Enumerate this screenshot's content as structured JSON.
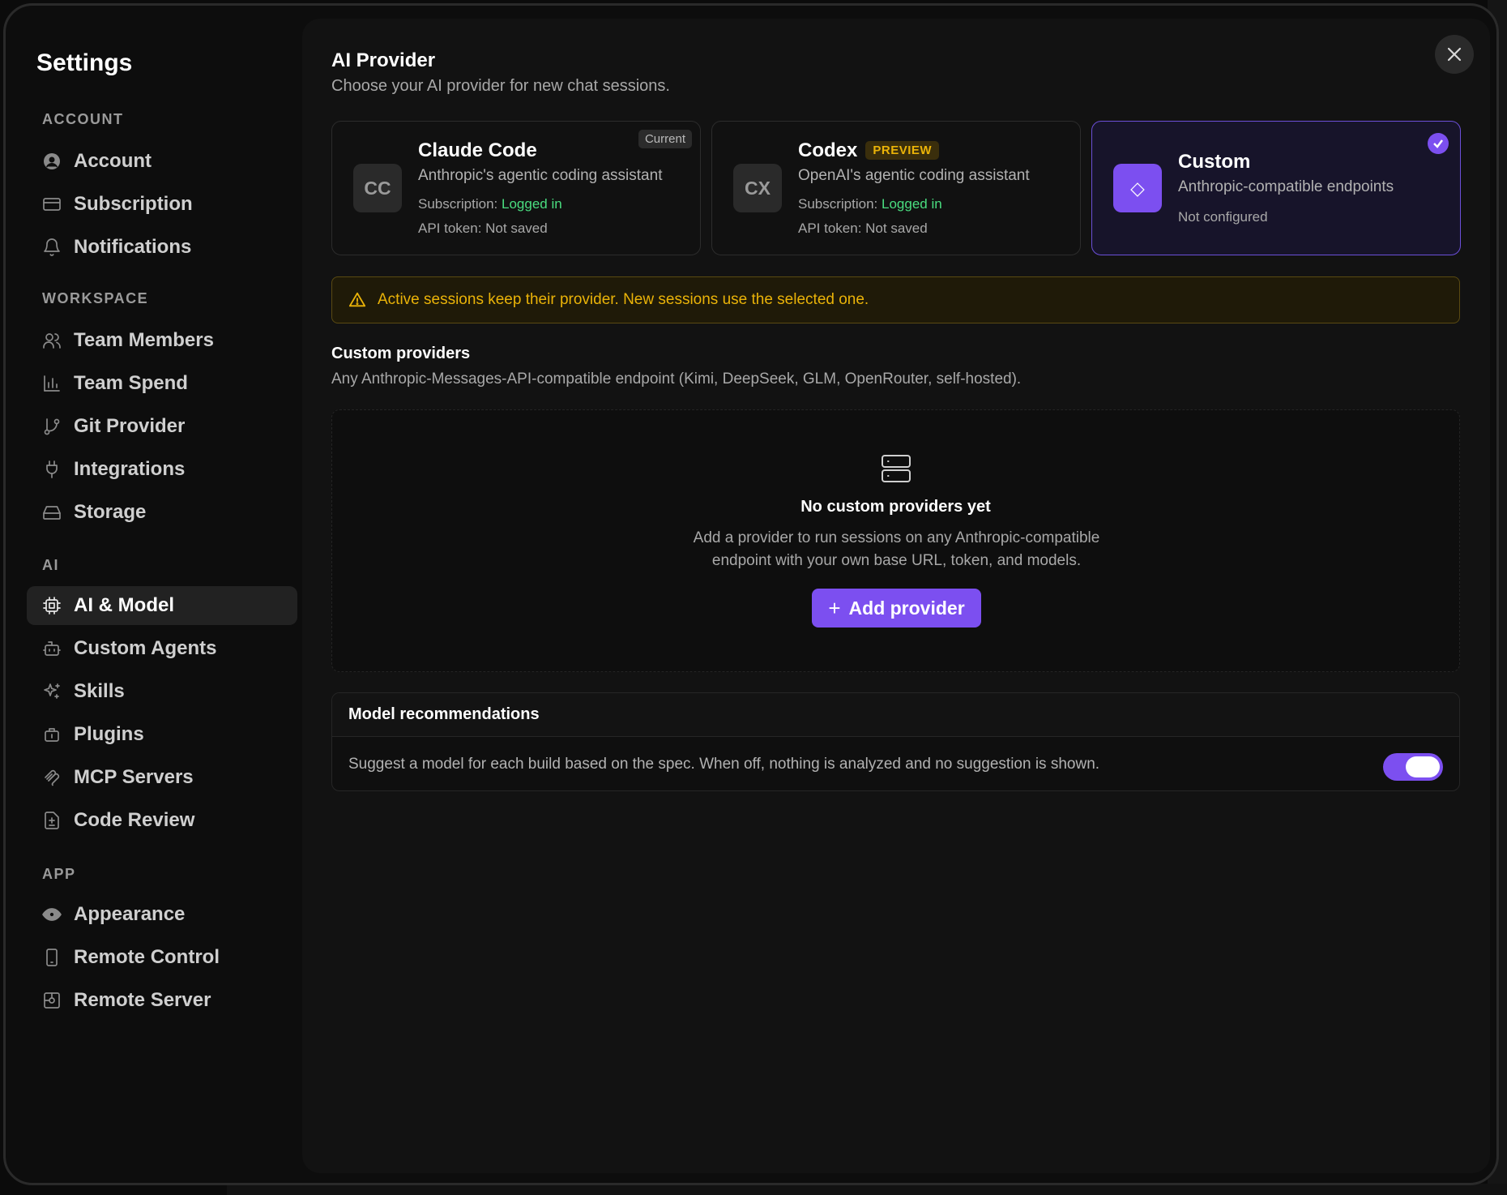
{
  "sidebar": {
    "title": "Settings",
    "groups": [
      {
        "label": "ACCOUNT"
      },
      {
        "label": "WORKSPACE"
      },
      {
        "label": "AI"
      },
      {
        "label": "APP"
      }
    ],
    "items": [
      {
        "label": "Account",
        "icon": "user-circle-icon"
      },
      {
        "label": "Subscription",
        "icon": "credit-card-icon"
      },
      {
        "label": "Notifications",
        "icon": "bell-icon"
      },
      {
        "label": "Team Members",
        "icon": "users-icon"
      },
      {
        "label": "Team Spend",
        "icon": "bar-chart-icon"
      },
      {
        "label": "Git Provider",
        "icon": "git-branch-icon"
      },
      {
        "label": "Integrations",
        "icon": "plug-icon"
      },
      {
        "label": "Storage",
        "icon": "hard-drive-icon"
      },
      {
        "label": "AI & Model",
        "icon": "cpu-icon",
        "active": true
      },
      {
        "label": "Custom Agents",
        "icon": "bot-icon"
      },
      {
        "label": "Skills",
        "icon": "sparkles-icon"
      },
      {
        "label": "Plugins",
        "icon": "puzzle-icon"
      },
      {
        "label": "MCP Servers",
        "icon": "mcp-icon"
      },
      {
        "label": "Code Review",
        "icon": "file-diff-icon"
      },
      {
        "label": "Appearance",
        "icon": "eye-icon"
      },
      {
        "label": "Remote Control",
        "icon": "smartphone-icon"
      },
      {
        "label": "Remote Server",
        "icon": "server-icon"
      }
    ]
  },
  "main": {
    "title": "AI Provider",
    "subtitle": "Choose your AI provider for new chat sessions.",
    "providers": [
      {
        "initials": "CC",
        "name": "Claude Code",
        "description": "Anthropic's agentic coding assistant",
        "subscription_label": "Subscription:",
        "subscription_status": "Logged in",
        "token_status": "API token: Not saved",
        "badge": "Current"
      },
      {
        "initials": "CX",
        "name": "Codex",
        "description": "OpenAI's agentic coding assistant",
        "subscription_label": "Subscription:",
        "subscription_status": "Logged in",
        "token_status": "API token: Not saved",
        "badge": "PREVIEW"
      },
      {
        "initials": "◇",
        "name": "Custom",
        "description": "Anthropic-compatible endpoints",
        "status": "Not configured",
        "selected": true
      }
    ],
    "alert": "Active sessions keep their provider. New sessions use the selected one.",
    "custom_providers": {
      "title": "Custom providers",
      "subtitle": "Any Anthropic-Messages-API-compatible endpoint (Kimi, DeepSeek, GLM, OpenRouter, self-hosted).",
      "empty_title": "No custom providers yet",
      "empty_description": "Add a provider to run sessions on any Anthropic-compatible endpoint with your own base URL, token, and models.",
      "add_button": "Add provider"
    },
    "model_recommendations": {
      "title": "Model recommendations",
      "description": "Suggest a model for each build based on the spec. When off, nothing is analyzed and no suggestion is shown.",
      "enabled": true
    }
  },
  "colors": {
    "accent": "#7c4ff0",
    "success": "#4ade80",
    "warning": "#eab308"
  }
}
